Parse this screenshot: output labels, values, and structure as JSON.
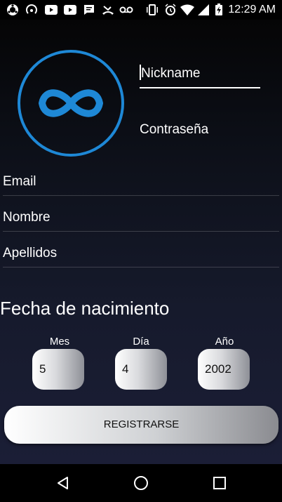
{
  "status_bar": {
    "time": "12:29 AM",
    "icons": [
      "ubuntu-icon",
      "hotspot-icon",
      "youtube-icon",
      "youtube-icon",
      "sms-icon",
      "missed-call-icon",
      "voicemail-icon",
      "vibrate-icon",
      "alarm-icon",
      "wifi-icon",
      "signal-icon",
      "battery-charging-icon"
    ]
  },
  "form": {
    "nickname_label": "Nickname",
    "password_label": "Contraseña",
    "email_label": "Email",
    "name_label": "Nombre",
    "surname_label": "Apellidos"
  },
  "birth": {
    "title": "Fecha de nacimiento",
    "month_label": "Mes",
    "day_label": "Día",
    "year_label": "Año",
    "month_value": "5",
    "day_value": "4",
    "year_value": "2002"
  },
  "register_label": "REGISTRARSE",
  "colors": {
    "logo_blue": "#1e88d6",
    "accent_white": "#ffffff"
  },
  "nav": {
    "icons": [
      "back-icon",
      "home-icon",
      "recents-icon"
    ]
  }
}
